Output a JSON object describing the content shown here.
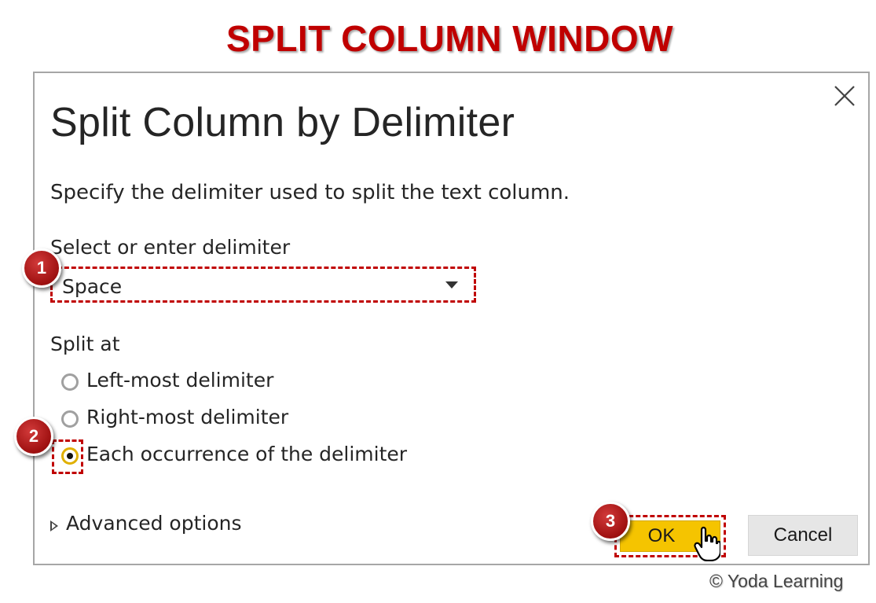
{
  "banner": {
    "title": "SPLIT COLUMN WINDOW"
  },
  "dialog": {
    "title": "Split Column by Delimiter",
    "description": "Specify the delimiter used to split the text column.",
    "delimiter": {
      "label": "Select or enter delimiter",
      "selected_value": "Space"
    },
    "split_at": {
      "label": "Split at",
      "options": [
        {
          "label": "Left-most delimiter",
          "selected": false
        },
        {
          "label": "Right-most delimiter",
          "selected": false
        },
        {
          "label": "Each occurrence of the delimiter",
          "selected": true
        }
      ]
    },
    "advanced_options_label": "Advanced options",
    "ok_label": "OK",
    "cancel_label": "Cancel"
  },
  "annotations": {
    "steps": [
      "1",
      "2",
      "3"
    ]
  },
  "footer": {
    "credit": "© Yoda Learning"
  },
  "colors": {
    "banner_red": "#c00000",
    "ok_yellow": "#f5c400",
    "badge_red": "#9e1010",
    "highlight_dash": "#c00000"
  },
  "icons": {
    "close": "close-icon",
    "dropdown": "chevron-down-icon",
    "expand": "triangle-right-icon",
    "cursor": "hand-cursor-icon"
  }
}
